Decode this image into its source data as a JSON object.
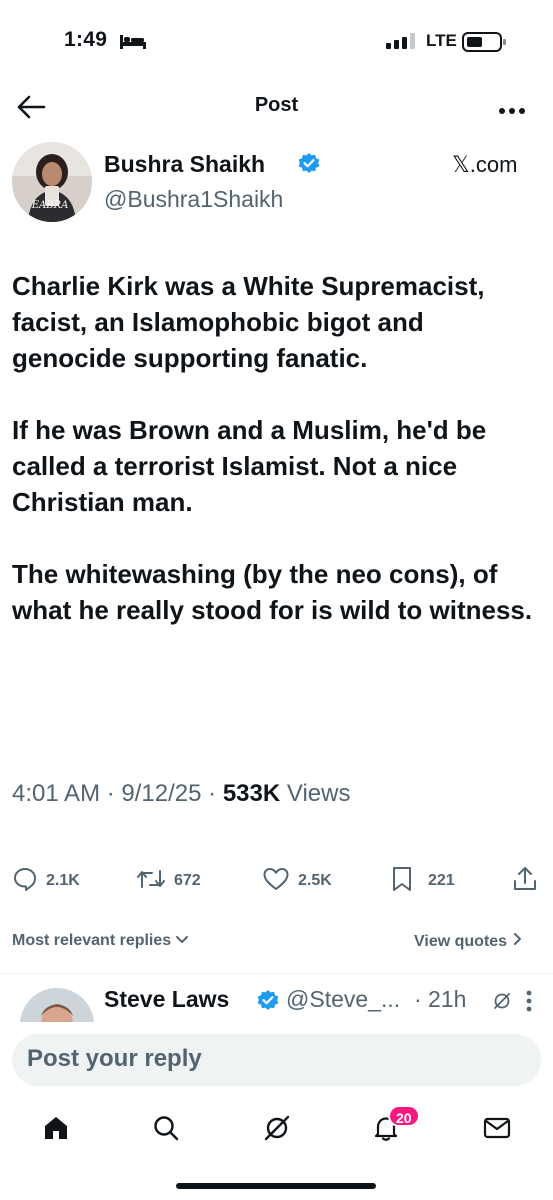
{
  "status_bar": {
    "time": "1:49",
    "network": "LTE"
  },
  "header": {
    "title": "Post"
  },
  "author": {
    "name": "Bushra Shaikh",
    "handle": "@Bushra1Shaikh",
    "source": "𝕏.com",
    "avatar_text": "EABRA"
  },
  "tweet": {
    "paragraphs": [
      "Charlie Kirk was a White Supremacist, facist, an Islamophobic bigot and genocide supporting fanatic.",
      "If he was Brown and a Muslim, he'd be called a terrorist Islamist. Not a nice Christian man.",
      "The whitewashing (by the neo cons), of what he really stood for is wild to witness."
    ],
    "time": "4:01 AM",
    "date": "9/12/25",
    "views_count": "533K",
    "views_label": "Views"
  },
  "actions": {
    "replies": "2.1K",
    "reposts": "672",
    "likes": "2.5K",
    "bookmarks": "221"
  },
  "replies_bar": {
    "sort_label": "Most relevant replies",
    "view_quotes_label": "View quotes"
  },
  "reply_preview": {
    "name": "Steve Laws",
    "handle": "@Steve_...",
    "time": "· 21h"
  },
  "composer": {
    "placeholder": "Post your reply"
  },
  "nav": {
    "notifications_badge": "20"
  },
  "colors": {
    "primary_text": "#0f1419",
    "secondary_text": "#536471",
    "verified_blue": "#1d9bf0",
    "badge_pink": "#f91880"
  },
  "icons": [
    "bed-icon",
    "signal-icon",
    "battery-icon",
    "back-arrow-icon",
    "more-icon",
    "verified-icon",
    "reply-icon",
    "repost-icon",
    "like-icon",
    "bookmark-icon",
    "share-icon",
    "chevron-down-icon",
    "chevron-right-icon",
    "grok-icon",
    "home-icon",
    "search-icon",
    "bell-icon",
    "mail-icon"
  ]
}
